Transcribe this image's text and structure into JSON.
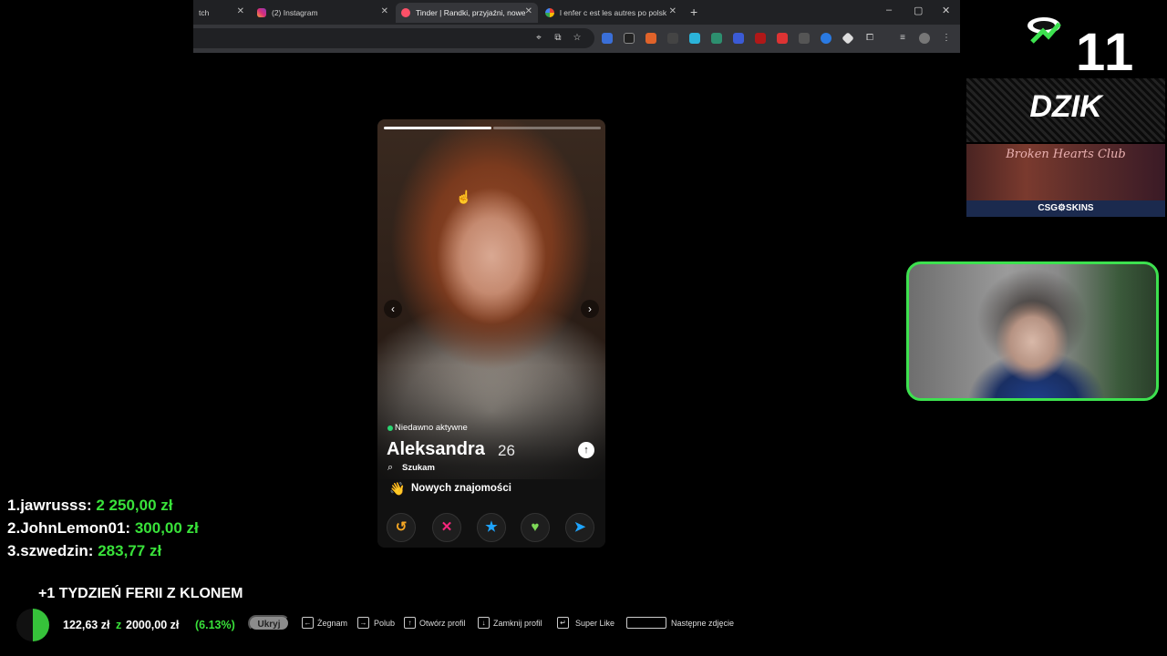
{
  "browser": {
    "tabs": [
      {
        "title": "tch",
        "favicon": "twitch-icon",
        "active": false
      },
      {
        "title": "(2) Instagram",
        "favicon": "instagram-icon",
        "active": false
      },
      {
        "title": "Tinder | Randki, przyjaźni, nowe",
        "favicon": "tinder-icon",
        "active": true
      },
      {
        "title": "l enfer c est les autres po polsk",
        "favicon": "google-icon",
        "active": false
      }
    ],
    "new_tab": "+",
    "window": {
      "minimize": "–",
      "restore": "▢",
      "close": "✕"
    }
  },
  "profile": {
    "status": "Niedawno aktywne",
    "name": "Aleksandra",
    "age": "26",
    "looking_label": "Szukam",
    "goal_emoji": "👋",
    "goal": "Nowych znajomości",
    "actions": [
      {
        "name": "rewind",
        "glyph": "↺",
        "color": "#f5a623"
      },
      {
        "name": "nope",
        "glyph": "✕",
        "color": "#fd267d"
      },
      {
        "name": "super-like",
        "glyph": "★",
        "color": "#1ea4fe"
      },
      {
        "name": "like",
        "glyph": "♥",
        "color": "#7ed957"
      },
      {
        "name": "boost",
        "glyph": "➤",
        "color": "#1ea4fe"
      }
    ]
  },
  "overlay": {
    "counter": "11",
    "sponsor": "DZIK",
    "csg_title": "Broken Hearts Club",
    "csg_label": "CSG⚙SKINS",
    "leaderboard": [
      {
        "rank": "1.",
        "user": "jawrusss:",
        "amount": "2 250,00 zł"
      },
      {
        "rank": "2.",
        "user": "JohnLemon01:",
        "amount": "300,00 zł"
      },
      {
        "rank": "3.",
        "user": "szwedzin:",
        "amount": "283,77 zł"
      }
    ],
    "promo": "+1 TYDZIEŃ FERII Z KLONEM",
    "goal_raised": "122,63 zł",
    "goal_z": "z",
    "goal_total": "2000,00 zł",
    "goal_pct": "(6.13%)",
    "goal_fraction": 0.0613
  },
  "shortcuts": {
    "hide": "Ukryj",
    "items": [
      {
        "key": "←",
        "label": "Żegnam"
      },
      {
        "key": "→",
        "label": "Polub"
      },
      {
        "key": "↑",
        "label": "Otwórz profil"
      },
      {
        "key": "↓",
        "label": "Zamknij profil"
      },
      {
        "key": "↵",
        "label": "Super Like"
      }
    ],
    "space_label": "Następne zdjęcie"
  }
}
